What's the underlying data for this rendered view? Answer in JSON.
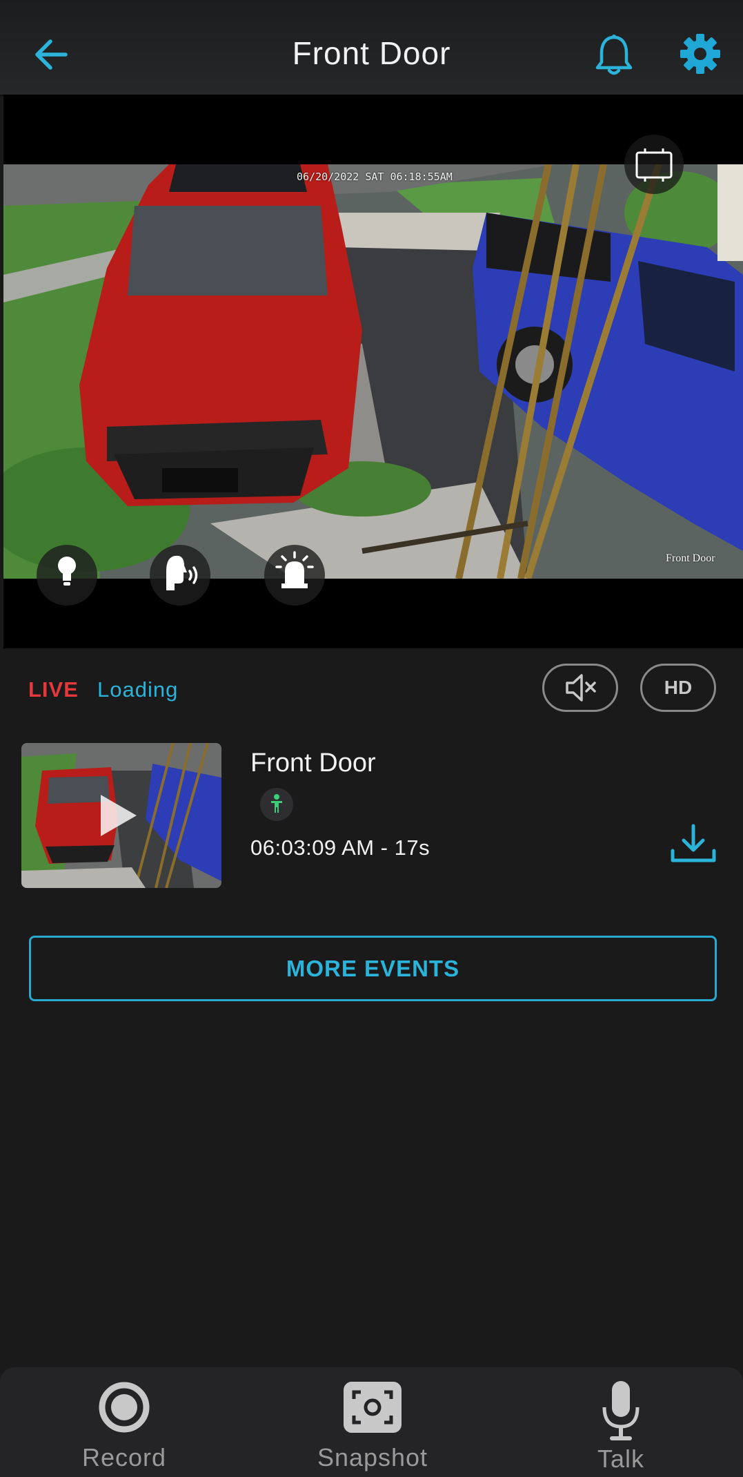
{
  "header": {
    "title": "Front Door",
    "back_icon": "arrow-left-icon",
    "bell_icon": "bell-icon",
    "settings_icon": "gear-icon"
  },
  "video": {
    "osd_timestamp": "06/20/2022 SAT 06:18:55AM",
    "osd_camera_name": "Front Door"
  },
  "status": {
    "live_label": "LIVE",
    "loading_label": "Loading",
    "hd_label": "HD"
  },
  "event": {
    "title": "Front Door",
    "time": "06:03:09 AM - 17s",
    "type_icon": "person-icon"
  },
  "more_events_label": "MORE EVENTS",
  "bottom_bar": {
    "record_label": "Record",
    "snapshot_label": "Snapshot",
    "talk_label": "Talk"
  },
  "colors": {
    "accent": "#2cb3d9",
    "live": "#e4383b",
    "background": "#1a1a1b",
    "person_badge": "#3ccf7a"
  }
}
